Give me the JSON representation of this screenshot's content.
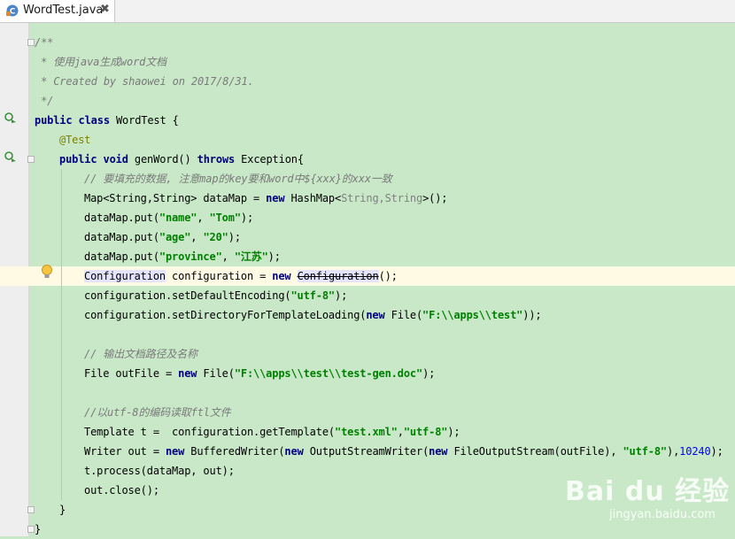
{
  "tab": {
    "title": "WordTest.java",
    "close": "✖"
  },
  "watermark": {
    "text": "Bai du 经验",
    "url": "jingyan.baidu.com"
  },
  "code": {
    "l1": "/**",
    "l2": " * 使用java生成word文档",
    "l3": " * Created by shaowei on 2017/8/31.",
    "l4": " */",
    "l5_kw": "public class",
    "l5_rest": " WordTest {",
    "l6": "@Test",
    "l7_kw1": "public void",
    "l7_mid": " genWord() ",
    "l7_kw2": "throws",
    "l7_rest": " Exception{",
    "l8": "// 要填充的数据, 注意map的key要和word中${xxx}的xxx一致",
    "l9_a": "Map<String,String> dataMap = ",
    "l9_new": "new",
    "l9_b": " HashMap<",
    "l9_g": "String,String",
    "l9_c": ">();",
    "l10_a": "dataMap.put(",
    "l10_s1": "\"name\"",
    "l10_b": ", ",
    "l10_s2": "\"Tom\"",
    "l10_c": ");",
    "l11_a": "dataMap.put(",
    "l11_s1": "\"age\"",
    "l11_b": ", ",
    "l11_s2": "\"20\"",
    "l11_c": ");",
    "l12_a": "dataMap.put(",
    "l12_s1": "\"province\"",
    "l12_b": ", ",
    "l12_s2": "\"江苏\"",
    "l12_c": ");",
    "l13_a": "Configuration",
    "l13_b": " configuration = ",
    "l13_new": "new",
    "l13_c": " ",
    "l13_d": "Configuration",
    "l13_e": "();",
    "l14_a": "configuration.setDefaultEncoding(",
    "l14_s": "\"utf-8\"",
    "l14_b": ");",
    "l15_a": "configuration.setDirectoryForTemplateLoading(",
    "l15_new": "new",
    "l15_b": " File(",
    "l15_s": "\"F:\\\\apps\\\\test\"",
    "l15_c": "));",
    "l17": "// 输出文档路径及名称",
    "l18_a": "File outFile = ",
    "l18_new": "new",
    "l18_b": " File(",
    "l18_s": "\"F:\\\\apps\\\\test\\\\test-gen.doc\"",
    "l18_c": ");",
    "l20": "//以utf-8的编码读取ftl文件",
    "l21_a": "Template t =  configuration.getTemplate(",
    "l21_s1": "\"test.xml\"",
    "l21_b": ",",
    "l21_s2": "\"utf-8\"",
    "l21_c": ");",
    "l22_a": "Writer out = ",
    "l22_new1": "new",
    "l22_b": " BufferedWriter(",
    "l22_new2": "new",
    "l22_c": " OutputStreamWriter(",
    "l22_new3": "new",
    "l22_d": " FileOutputStream(outFile), ",
    "l22_s": "\"utf-8\"",
    "l22_e": "),",
    "l22_n": "10240",
    "l22_f": ");",
    "l23": "t.process(dataMap, out);",
    "l24": "out.close();",
    "l25": "}",
    "l26": "}"
  },
  "colors": {
    "background": "#c8e8c8",
    "keyword": "#000080",
    "string": "#008000",
    "comment": "#7a7a7a",
    "number": "#0000ff",
    "annotation": "#808000"
  }
}
